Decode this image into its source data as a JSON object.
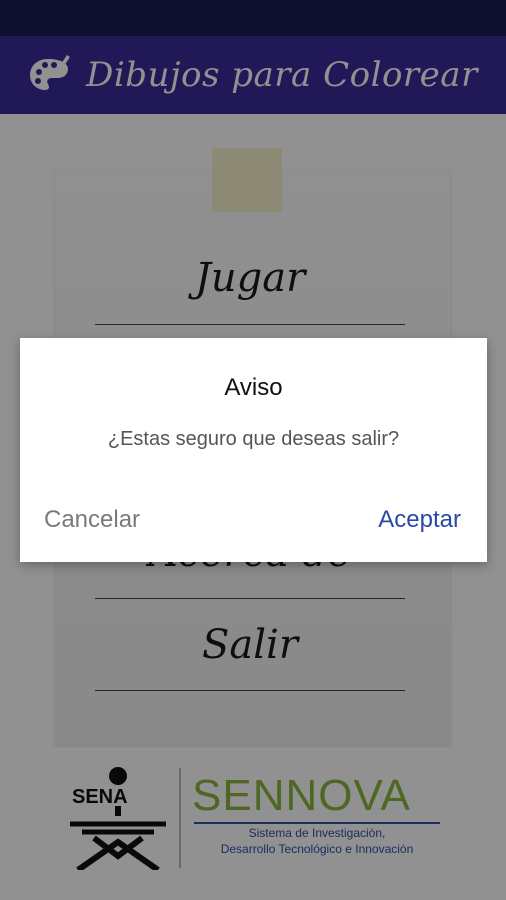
{
  "app": {
    "title": "Dibujos para Colorear",
    "icon": "palette-icon"
  },
  "menu": {
    "items": [
      {
        "label": "Jugar"
      },
      {
        "label": "Acerca de"
      },
      {
        "label": "Salir"
      }
    ]
  },
  "dialog": {
    "title": "Aviso",
    "message": "¿Estas seguro que deseas salir?",
    "cancel_label": "Cancelar",
    "accept_label": "Aceptar"
  },
  "footer": {
    "sena_label": "SENA",
    "sennova_label": "SENNOVA",
    "sennova_subtitle_line1": "Sistema de Investigación,",
    "sennova_subtitle_line2": "Desarrollo Tecnológico e Innovación"
  },
  "colors": {
    "status_bar": "#1c1c55",
    "app_bar": "#3b2b9c",
    "accent_button": "#2b48a8",
    "sennova_green": "#8ab63f",
    "sennova_blue": "#3050a8"
  }
}
